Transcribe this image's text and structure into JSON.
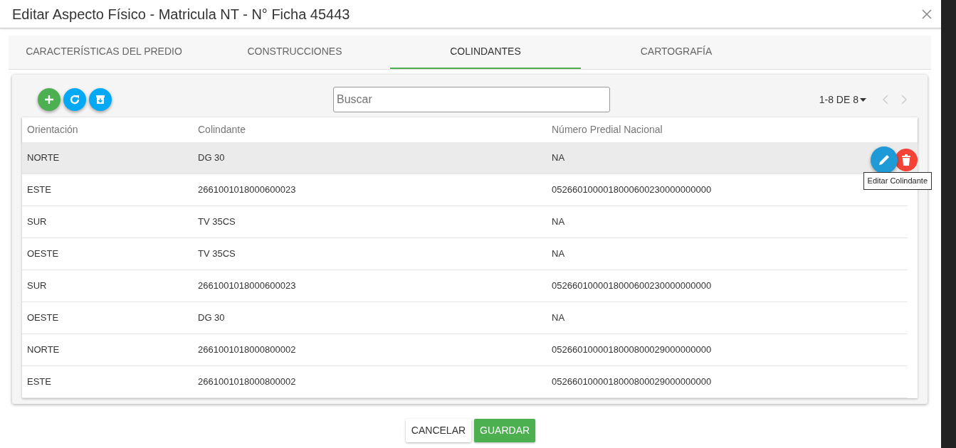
{
  "dialog": {
    "title": "Editar Aspecto Físico - Matricula NT - N° Ficha 45443"
  },
  "tabs": [
    {
      "label": "CARACTERÍSTICAS DEL PREDIO",
      "selected": false
    },
    {
      "label": "CONSTRUCCIONES",
      "selected": false
    },
    {
      "label": "COLINDANTES",
      "selected": true
    },
    {
      "label": "CARTOGRAFÍA",
      "selected": false
    }
  ],
  "search": {
    "placeholder": "Buscar"
  },
  "pagination": {
    "range": "1-8 DE 8"
  },
  "table": {
    "columns": [
      "Orientación",
      "Colindante",
      "Número Predial Nacional"
    ],
    "rows": [
      {
        "cells": [
          "NORTE",
          "DG 30",
          "NA"
        ],
        "selected": true
      },
      {
        "cells": [
          "ESTE",
          "2661001018000600023",
          "0526601000018000600230000000000"
        ],
        "selected": false
      },
      {
        "cells": [
          "SUR",
          "TV 35CS",
          "NA"
        ],
        "selected": false
      },
      {
        "cells": [
          "OESTE",
          "TV 35CS",
          "NA"
        ],
        "selected": false
      },
      {
        "cells": [
          "SUR",
          "2661001018000600023",
          "0526601000018000600230000000000"
        ],
        "selected": false
      },
      {
        "cells": [
          "OESTE",
          "DG 30",
          "NA"
        ],
        "selected": false
      },
      {
        "cells": [
          "NORTE",
          "2661001018000800002",
          "0526601000018000800029000000000"
        ],
        "selected": false
      },
      {
        "cells": [
          "ESTE",
          "2661001018000800002",
          "0526601000018000800029000000000"
        ],
        "selected": false
      }
    ]
  },
  "tooltip": "Editar Colindante",
  "buttons": [
    {
      "label": "CANCELAR",
      "kind": "secondary"
    },
    {
      "label": "GUARDAR",
      "kind": "primary"
    }
  ]
}
